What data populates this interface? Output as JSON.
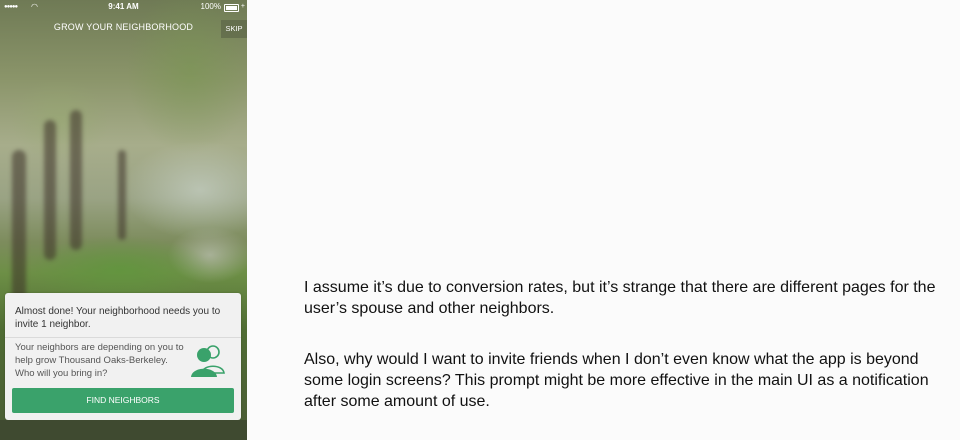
{
  "status_bar": {
    "signal": "●●●●●",
    "time": "9:41 AM",
    "battery": "100%"
  },
  "nav": {
    "title": "GROW YOUR NEIGHBORHOOD",
    "skip_label": "SKIP"
  },
  "invite_card": {
    "headline": "Almost done! Your neighborhood needs you to invite 1 neighbor.",
    "body": "Your neighbors are depending on you to help grow Thousand Oaks-Berkeley. Who will you bring in?",
    "icon": "people-icon",
    "button_label": "FIND NEIGHBORS",
    "accent_color": "#3aa26b"
  },
  "commentary": [
    "I assume it’s due to conversion rates, but it’s strange that there are different pages for the user’s spouse and other neighbors.",
    "Also, why would I want to invite friends when I don’t even know what the app is beyond some login screens? This prompt might be more effective in the main UI as a notification after some amount of use."
  ]
}
